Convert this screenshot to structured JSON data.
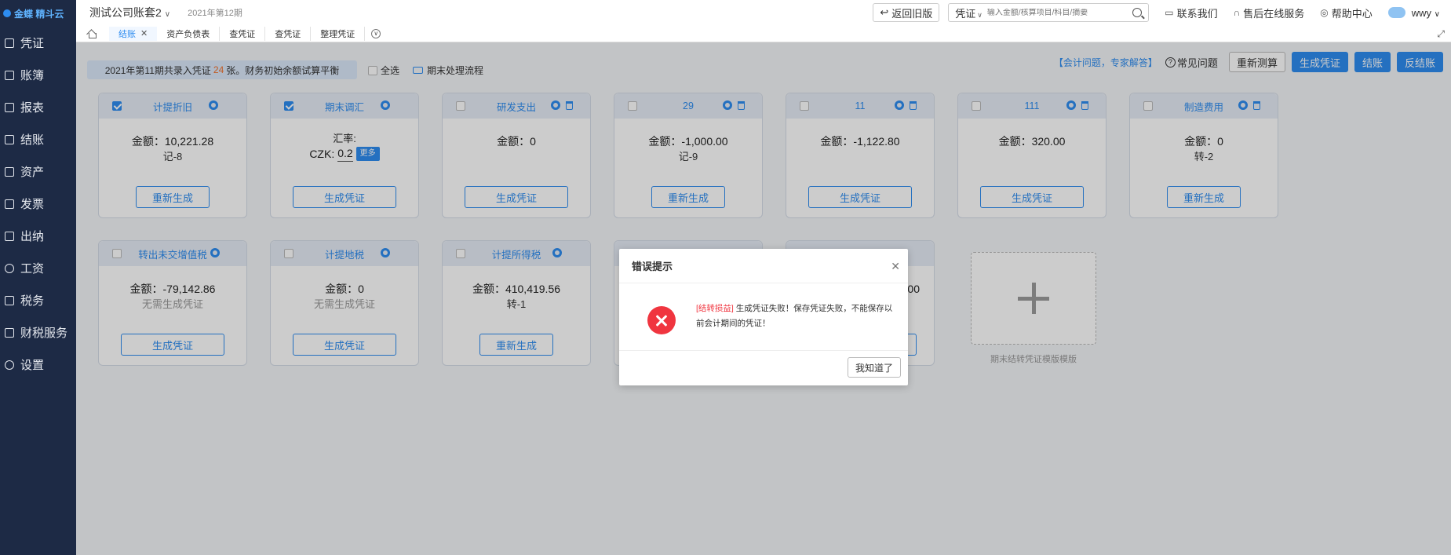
{
  "app": {
    "logo_text": "金蝶 精斗云"
  },
  "sidebar": {
    "items": [
      {
        "label": "凭证",
        "icon": "voucher-icon"
      },
      {
        "label": "账簿",
        "icon": "ledger-icon"
      },
      {
        "label": "报表",
        "icon": "report-icon"
      },
      {
        "label": "结账",
        "icon": "closing-icon"
      },
      {
        "label": "资产",
        "icon": "asset-icon"
      },
      {
        "label": "发票",
        "icon": "invoice-icon"
      },
      {
        "label": "出纳",
        "icon": "cashier-icon"
      },
      {
        "label": "工资",
        "icon": "salary-icon"
      },
      {
        "label": "税务",
        "icon": "tax-icon"
      },
      {
        "label": "财税服务",
        "icon": "service-icon"
      },
      {
        "label": "设置",
        "icon": "settings-icon"
      }
    ]
  },
  "header": {
    "company": "测试公司账套2",
    "period": "2021年第12期",
    "old_version": "返回旧版",
    "search_type": "凭证",
    "search_placeholder": "输入金额/核算项目/科目/摘要",
    "contact": "联系我们",
    "online_service": "售后在线服务",
    "help": "帮助中心",
    "user": "wwy"
  },
  "tabs": [
    {
      "label": "结账",
      "active": true
    },
    {
      "label": "资产负债表",
      "active": false
    },
    {
      "label": "查凭证",
      "active": false
    },
    {
      "label": "查凭证",
      "active": false
    },
    {
      "label": "整理凭证",
      "active": false
    }
  ],
  "toolbar": {
    "notice_prefix": "2021年第11期共录入凭证",
    "notice_count": "24",
    "notice_suffix": "张。财务初始余额试算平衡",
    "select_all": "全选",
    "flow": "期末处理流程",
    "expert": "【会计问题，专家解答】",
    "faq": "常见问题",
    "recalc": "重新测算",
    "gen_voucher": "生成凭证",
    "close": "结账",
    "unclose": "反结账"
  },
  "cards": [
    {
      "title": "计提折旧",
      "checked": true,
      "amount_label": "金额：",
      "amount": "10,221.28",
      "sub": "记-8",
      "button": "重新生成",
      "trash": false
    },
    {
      "title": "期末调汇",
      "checked": true,
      "rate_label": "汇率:",
      "rate_currency": "CZK:",
      "rate_value": "0.2",
      "more": "更多",
      "button": "生成凭证",
      "trash": false
    },
    {
      "title": "研发支出",
      "checked": false,
      "amount_label": "金额：",
      "amount": "0",
      "button": "生成凭证",
      "trash": true
    },
    {
      "title": "29",
      "checked": false,
      "amount_label": "金额：",
      "amount": "-1,000.00",
      "sub": "记-9",
      "button": "重新生成",
      "trash": true
    },
    {
      "title": "11",
      "checked": false,
      "amount_label": "金额：",
      "amount": "-1,122.80",
      "button": "生成凭证",
      "trash": true
    },
    {
      "title": "111",
      "checked": false,
      "amount_label": "金额：",
      "amount": "320.00",
      "button": "生成凭证",
      "trash": true
    },
    {
      "title": "制造费用",
      "checked": false,
      "amount_label": "金额：",
      "amount": "0",
      "sub": "转-2",
      "button": "重新生成",
      "trash": true
    },
    {
      "title": "转出未交增值税",
      "checked": false,
      "amount_label": "金额：",
      "amount": "-79,142.86",
      "muted": "无需生成凭证",
      "button": "生成凭证",
      "trash": false
    },
    {
      "title": "计提地税",
      "checked": false,
      "amount_label": "金额：",
      "amount": "0",
      "muted": "无需生成凭证",
      "button": "生成凭证",
      "trash": false
    },
    {
      "title": "计提所得税",
      "checked": false,
      "amount_label": "金额：",
      "amount": "410,419.56",
      "sub": "转-1",
      "button": "重新生成",
      "trash": false
    },
    {
      "partial_amount": ".00"
    }
  ],
  "add_template": "期末结转凭证模版模版",
  "modal": {
    "title": "错误提示",
    "tag": "[结转损益]",
    "message": "生成凭证失败！保存凭证失败，不能保存以前会计期间的凭证！",
    "ok": "我知道了"
  }
}
